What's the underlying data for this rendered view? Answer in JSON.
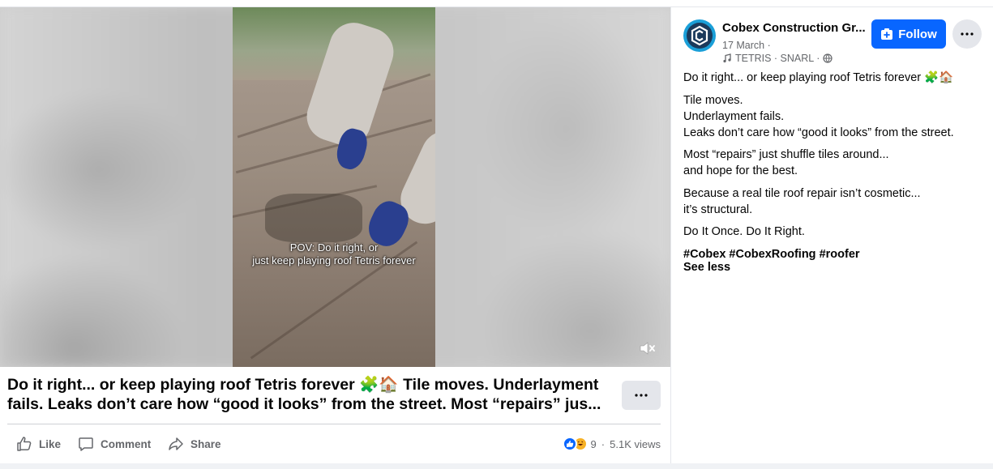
{
  "video": {
    "caption_line1": "POV: Do it right, or",
    "caption_line2": "just keep playing roof Tetris forever"
  },
  "post_title": "Do it right... or keep playing roof Tetris forever 🧩🏠 Tile moves. Underlayment fails. Leaks don’t care how “good it looks” from the street. Most “repairs” jus...",
  "actions": {
    "like": "Like",
    "comment": "Comment",
    "share": "Share"
  },
  "stats": {
    "reaction_count": "9",
    "separator": "·",
    "views": "5.1K views"
  },
  "page": {
    "name": "Cobex Construction Gr...",
    "date": "17 March ·",
    "audio": "TETRIS · SNARL ·",
    "follow_label": "Follow"
  },
  "post": {
    "line1": "Do it right... or keep playing roof Tetris forever 🧩🏠",
    "p2_l1": "Tile moves.",
    "p2_l2": "Underlayment fails.",
    "p2_l3": "Leaks don’t care how “good it looks” from the street.",
    "p3_l1": "Most “repairs” just shuffle tiles around...",
    "p3_l2": "and hope for the best.",
    "p4_l1": "Because a real tile roof repair isn’t cosmetic...",
    "p4_l2": "it’s structural.",
    "p5": "Do It Once. Do It Right.",
    "hashtags": "#Cobex #CobexRoofing #roofer",
    "see_less": "See less"
  },
  "colors": {
    "accent": "#0866ff",
    "avatar": "#1a9fd8",
    "secondary_text": "#65676b"
  },
  "icons": [
    "mute-icon",
    "like-icon",
    "comment-icon",
    "share-icon",
    "more-icon",
    "follow-plus-icon",
    "music-note-icon",
    "globe-icon",
    "like-reaction-icon",
    "haha-reaction-icon"
  ]
}
